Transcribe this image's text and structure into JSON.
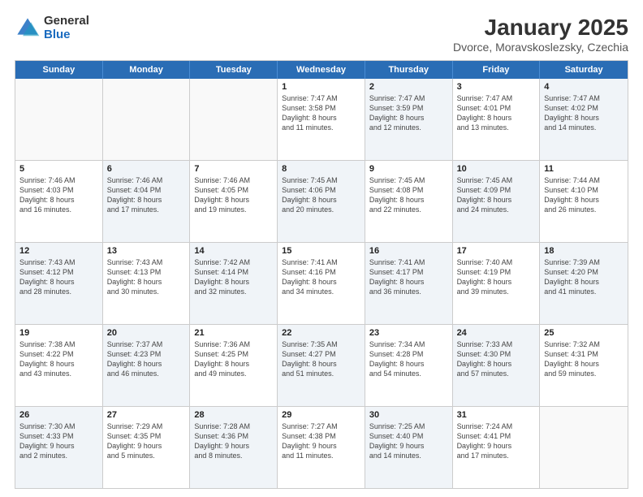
{
  "logo": {
    "general": "General",
    "blue": "Blue"
  },
  "title": "January 2025",
  "subtitle": "Dvorce, Moravskoslezsky, Czechia",
  "days_of_week": [
    "Sunday",
    "Monday",
    "Tuesday",
    "Wednesday",
    "Thursday",
    "Friday",
    "Saturday"
  ],
  "weeks": [
    [
      {
        "day": "",
        "info": "",
        "empty": true
      },
      {
        "day": "",
        "info": "",
        "empty": true
      },
      {
        "day": "",
        "info": "",
        "empty": true
      },
      {
        "day": "1",
        "info": "Sunrise: 7:47 AM\nSunset: 3:58 PM\nDaylight: 8 hours\nand 11 minutes."
      },
      {
        "day": "2",
        "info": "Sunrise: 7:47 AM\nSunset: 3:59 PM\nDaylight: 8 hours\nand 12 minutes."
      },
      {
        "day": "3",
        "info": "Sunrise: 7:47 AM\nSunset: 4:01 PM\nDaylight: 8 hours\nand 13 minutes."
      },
      {
        "day": "4",
        "info": "Sunrise: 7:47 AM\nSunset: 4:02 PM\nDaylight: 8 hours\nand 14 minutes."
      }
    ],
    [
      {
        "day": "5",
        "info": "Sunrise: 7:46 AM\nSunset: 4:03 PM\nDaylight: 8 hours\nand 16 minutes."
      },
      {
        "day": "6",
        "info": "Sunrise: 7:46 AM\nSunset: 4:04 PM\nDaylight: 8 hours\nand 17 minutes."
      },
      {
        "day": "7",
        "info": "Sunrise: 7:46 AM\nSunset: 4:05 PM\nDaylight: 8 hours\nand 19 minutes."
      },
      {
        "day": "8",
        "info": "Sunrise: 7:45 AM\nSunset: 4:06 PM\nDaylight: 8 hours\nand 20 minutes."
      },
      {
        "day": "9",
        "info": "Sunrise: 7:45 AM\nSunset: 4:08 PM\nDaylight: 8 hours\nand 22 minutes."
      },
      {
        "day": "10",
        "info": "Sunrise: 7:45 AM\nSunset: 4:09 PM\nDaylight: 8 hours\nand 24 minutes."
      },
      {
        "day": "11",
        "info": "Sunrise: 7:44 AM\nSunset: 4:10 PM\nDaylight: 8 hours\nand 26 minutes."
      }
    ],
    [
      {
        "day": "12",
        "info": "Sunrise: 7:43 AM\nSunset: 4:12 PM\nDaylight: 8 hours\nand 28 minutes."
      },
      {
        "day": "13",
        "info": "Sunrise: 7:43 AM\nSunset: 4:13 PM\nDaylight: 8 hours\nand 30 minutes."
      },
      {
        "day": "14",
        "info": "Sunrise: 7:42 AM\nSunset: 4:14 PM\nDaylight: 8 hours\nand 32 minutes."
      },
      {
        "day": "15",
        "info": "Sunrise: 7:41 AM\nSunset: 4:16 PM\nDaylight: 8 hours\nand 34 minutes."
      },
      {
        "day": "16",
        "info": "Sunrise: 7:41 AM\nSunset: 4:17 PM\nDaylight: 8 hours\nand 36 minutes."
      },
      {
        "day": "17",
        "info": "Sunrise: 7:40 AM\nSunset: 4:19 PM\nDaylight: 8 hours\nand 39 minutes."
      },
      {
        "day": "18",
        "info": "Sunrise: 7:39 AM\nSunset: 4:20 PM\nDaylight: 8 hours\nand 41 minutes."
      }
    ],
    [
      {
        "day": "19",
        "info": "Sunrise: 7:38 AM\nSunset: 4:22 PM\nDaylight: 8 hours\nand 43 minutes."
      },
      {
        "day": "20",
        "info": "Sunrise: 7:37 AM\nSunset: 4:23 PM\nDaylight: 8 hours\nand 46 minutes."
      },
      {
        "day": "21",
        "info": "Sunrise: 7:36 AM\nSunset: 4:25 PM\nDaylight: 8 hours\nand 49 minutes."
      },
      {
        "day": "22",
        "info": "Sunrise: 7:35 AM\nSunset: 4:27 PM\nDaylight: 8 hours\nand 51 minutes."
      },
      {
        "day": "23",
        "info": "Sunrise: 7:34 AM\nSunset: 4:28 PM\nDaylight: 8 hours\nand 54 minutes."
      },
      {
        "day": "24",
        "info": "Sunrise: 7:33 AM\nSunset: 4:30 PM\nDaylight: 8 hours\nand 57 minutes."
      },
      {
        "day": "25",
        "info": "Sunrise: 7:32 AM\nSunset: 4:31 PM\nDaylight: 8 hours\nand 59 minutes."
      }
    ],
    [
      {
        "day": "26",
        "info": "Sunrise: 7:30 AM\nSunset: 4:33 PM\nDaylight: 9 hours\nand 2 minutes."
      },
      {
        "day": "27",
        "info": "Sunrise: 7:29 AM\nSunset: 4:35 PM\nDaylight: 9 hours\nand 5 minutes."
      },
      {
        "day": "28",
        "info": "Sunrise: 7:28 AM\nSunset: 4:36 PM\nDaylight: 9 hours\nand 8 minutes."
      },
      {
        "day": "29",
        "info": "Sunrise: 7:27 AM\nSunset: 4:38 PM\nDaylight: 9 hours\nand 11 minutes."
      },
      {
        "day": "30",
        "info": "Sunrise: 7:25 AM\nSunset: 4:40 PM\nDaylight: 9 hours\nand 14 minutes."
      },
      {
        "day": "31",
        "info": "Sunrise: 7:24 AM\nSunset: 4:41 PM\nDaylight: 9 hours\nand 17 minutes."
      },
      {
        "day": "",
        "info": "",
        "empty": true
      }
    ]
  ]
}
